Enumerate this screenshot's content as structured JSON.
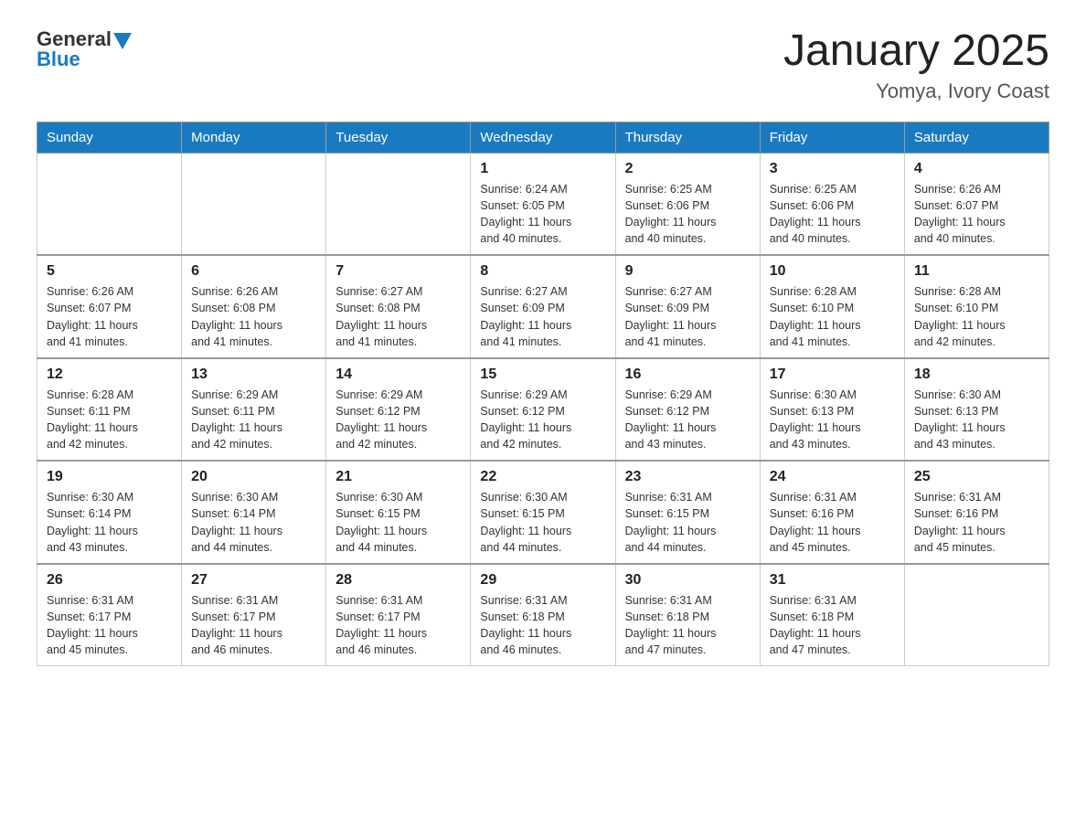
{
  "header": {
    "logo_text1": "General",
    "logo_text2": "Blue",
    "month_title": "January 2025",
    "subtitle": "Yomya, Ivory Coast"
  },
  "days_of_week": [
    "Sunday",
    "Monday",
    "Tuesday",
    "Wednesday",
    "Thursday",
    "Friday",
    "Saturday"
  ],
  "weeks": [
    [
      {
        "day": "",
        "info": ""
      },
      {
        "day": "",
        "info": ""
      },
      {
        "day": "",
        "info": ""
      },
      {
        "day": "1",
        "info": "Sunrise: 6:24 AM\nSunset: 6:05 PM\nDaylight: 11 hours\nand 40 minutes."
      },
      {
        "day": "2",
        "info": "Sunrise: 6:25 AM\nSunset: 6:06 PM\nDaylight: 11 hours\nand 40 minutes."
      },
      {
        "day": "3",
        "info": "Sunrise: 6:25 AM\nSunset: 6:06 PM\nDaylight: 11 hours\nand 40 minutes."
      },
      {
        "day": "4",
        "info": "Sunrise: 6:26 AM\nSunset: 6:07 PM\nDaylight: 11 hours\nand 40 minutes."
      }
    ],
    [
      {
        "day": "5",
        "info": "Sunrise: 6:26 AM\nSunset: 6:07 PM\nDaylight: 11 hours\nand 41 minutes."
      },
      {
        "day": "6",
        "info": "Sunrise: 6:26 AM\nSunset: 6:08 PM\nDaylight: 11 hours\nand 41 minutes."
      },
      {
        "day": "7",
        "info": "Sunrise: 6:27 AM\nSunset: 6:08 PM\nDaylight: 11 hours\nand 41 minutes."
      },
      {
        "day": "8",
        "info": "Sunrise: 6:27 AM\nSunset: 6:09 PM\nDaylight: 11 hours\nand 41 minutes."
      },
      {
        "day": "9",
        "info": "Sunrise: 6:27 AM\nSunset: 6:09 PM\nDaylight: 11 hours\nand 41 minutes."
      },
      {
        "day": "10",
        "info": "Sunrise: 6:28 AM\nSunset: 6:10 PM\nDaylight: 11 hours\nand 41 minutes."
      },
      {
        "day": "11",
        "info": "Sunrise: 6:28 AM\nSunset: 6:10 PM\nDaylight: 11 hours\nand 42 minutes."
      }
    ],
    [
      {
        "day": "12",
        "info": "Sunrise: 6:28 AM\nSunset: 6:11 PM\nDaylight: 11 hours\nand 42 minutes."
      },
      {
        "day": "13",
        "info": "Sunrise: 6:29 AM\nSunset: 6:11 PM\nDaylight: 11 hours\nand 42 minutes."
      },
      {
        "day": "14",
        "info": "Sunrise: 6:29 AM\nSunset: 6:12 PM\nDaylight: 11 hours\nand 42 minutes."
      },
      {
        "day": "15",
        "info": "Sunrise: 6:29 AM\nSunset: 6:12 PM\nDaylight: 11 hours\nand 42 minutes."
      },
      {
        "day": "16",
        "info": "Sunrise: 6:29 AM\nSunset: 6:12 PM\nDaylight: 11 hours\nand 43 minutes."
      },
      {
        "day": "17",
        "info": "Sunrise: 6:30 AM\nSunset: 6:13 PM\nDaylight: 11 hours\nand 43 minutes."
      },
      {
        "day": "18",
        "info": "Sunrise: 6:30 AM\nSunset: 6:13 PM\nDaylight: 11 hours\nand 43 minutes."
      }
    ],
    [
      {
        "day": "19",
        "info": "Sunrise: 6:30 AM\nSunset: 6:14 PM\nDaylight: 11 hours\nand 43 minutes."
      },
      {
        "day": "20",
        "info": "Sunrise: 6:30 AM\nSunset: 6:14 PM\nDaylight: 11 hours\nand 44 minutes."
      },
      {
        "day": "21",
        "info": "Sunrise: 6:30 AM\nSunset: 6:15 PM\nDaylight: 11 hours\nand 44 minutes."
      },
      {
        "day": "22",
        "info": "Sunrise: 6:30 AM\nSunset: 6:15 PM\nDaylight: 11 hours\nand 44 minutes."
      },
      {
        "day": "23",
        "info": "Sunrise: 6:31 AM\nSunset: 6:15 PM\nDaylight: 11 hours\nand 44 minutes."
      },
      {
        "day": "24",
        "info": "Sunrise: 6:31 AM\nSunset: 6:16 PM\nDaylight: 11 hours\nand 45 minutes."
      },
      {
        "day": "25",
        "info": "Sunrise: 6:31 AM\nSunset: 6:16 PM\nDaylight: 11 hours\nand 45 minutes."
      }
    ],
    [
      {
        "day": "26",
        "info": "Sunrise: 6:31 AM\nSunset: 6:17 PM\nDaylight: 11 hours\nand 45 minutes."
      },
      {
        "day": "27",
        "info": "Sunrise: 6:31 AM\nSunset: 6:17 PM\nDaylight: 11 hours\nand 46 minutes."
      },
      {
        "day": "28",
        "info": "Sunrise: 6:31 AM\nSunset: 6:17 PM\nDaylight: 11 hours\nand 46 minutes."
      },
      {
        "day": "29",
        "info": "Sunrise: 6:31 AM\nSunset: 6:18 PM\nDaylight: 11 hours\nand 46 minutes."
      },
      {
        "day": "30",
        "info": "Sunrise: 6:31 AM\nSunset: 6:18 PM\nDaylight: 11 hours\nand 47 minutes."
      },
      {
        "day": "31",
        "info": "Sunrise: 6:31 AM\nSunset: 6:18 PM\nDaylight: 11 hours\nand 47 minutes."
      },
      {
        "day": "",
        "info": ""
      }
    ]
  ]
}
